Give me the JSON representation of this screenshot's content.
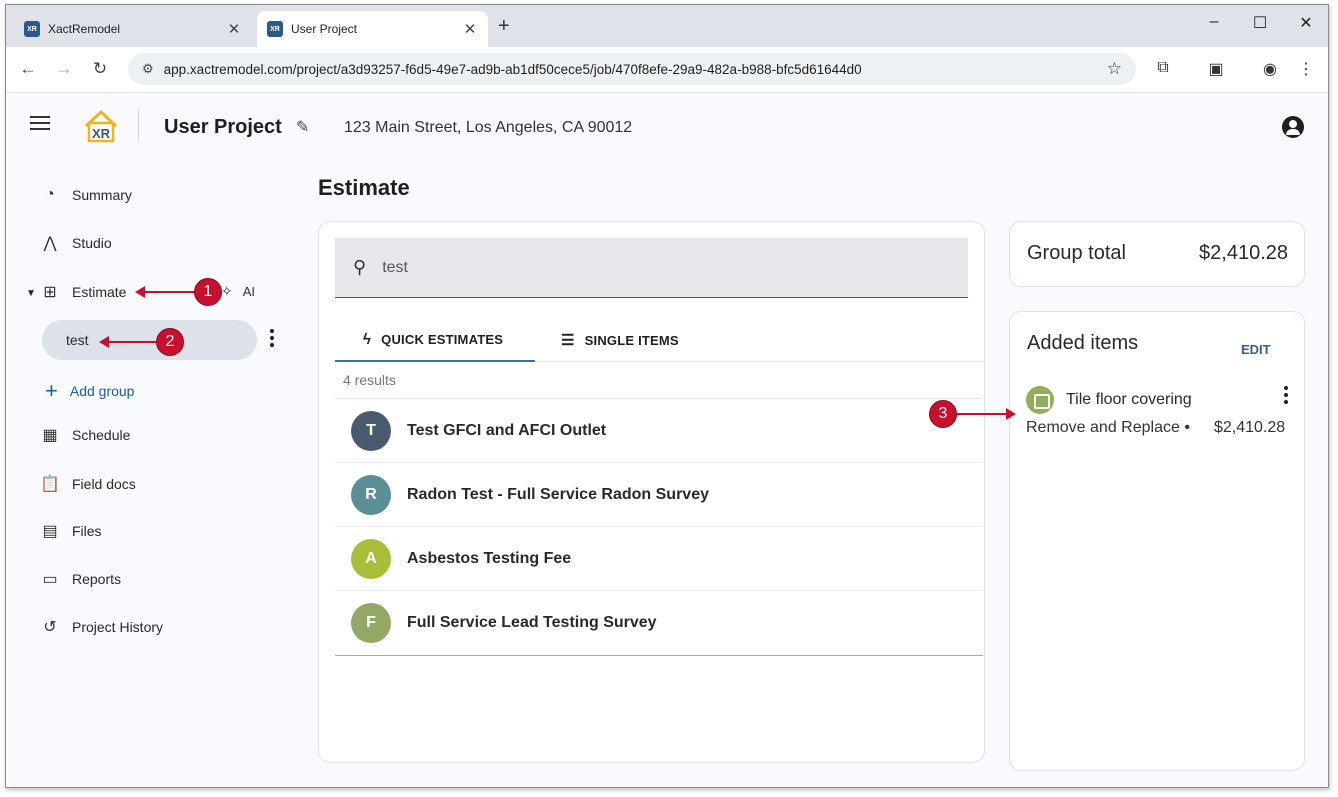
{
  "browser": {
    "tabs": [
      {
        "label": "XactRemodel",
        "favicon": "xr-favicon",
        "close": "✕"
      },
      {
        "label": "User Project",
        "favicon": "xr-favicon",
        "close": "✕"
      }
    ],
    "new_tab": "+",
    "window_controls": {
      "minimize": "–",
      "maximize": "☐",
      "close": "✕"
    },
    "url": "app.xactremodel.com/project/a3d93257-f6d5-49e7-ad9b-ab1df50cece5/job/470f8efe-29a9-482a-b988-bfc5d61644d0",
    "favicon_text": "XR"
  },
  "header": {
    "logo_text": "XR",
    "project_title": "User Project",
    "address": "123 Main Street, Los Angeles, CA 90012"
  },
  "sidebar": {
    "items": [
      {
        "label": "Summary",
        "icon": "gauge-icon"
      },
      {
        "label": "Studio",
        "icon": "compass-icon"
      },
      {
        "label": "Estimate",
        "icon": "calculator-icon"
      },
      {
        "label": "Schedule",
        "icon": "calendar-icon"
      },
      {
        "label": "Field docs",
        "icon": "clipboard-plus-icon"
      },
      {
        "label": "Files",
        "icon": "photo-library-icon"
      },
      {
        "label": "Reports",
        "icon": "document-icon"
      },
      {
        "label": "Project History",
        "icon": "history-icon"
      }
    ],
    "ai_label": "AI",
    "group": "test",
    "add_group": "Add group"
  },
  "main": {
    "heading": "Estimate",
    "search_value": "test",
    "tabs": [
      {
        "label": "QUICK ESTIMATES",
        "icon": "bolt-icon"
      },
      {
        "label": "SINGLE ITEMS",
        "icon": "list-icon"
      }
    ],
    "results_count": "4 results",
    "results": [
      {
        "initial": "T",
        "label": "Test GFCI and AFCI Outlet",
        "color": "#4a5a6e"
      },
      {
        "initial": "R",
        "label": "Radon Test - Full Service Radon Survey",
        "color": "#5b8f95"
      },
      {
        "initial": "A",
        "label": "Asbestos Testing Fee",
        "color": "#a9bd37"
      },
      {
        "initial": "F",
        "label": "Full Service Lead Testing Survey",
        "color": "#93a864"
      }
    ]
  },
  "summary": {
    "group_total_label": "Group total",
    "group_total_value": "$2,410.28",
    "added_items_label": "Added items",
    "edit_label": "EDIT",
    "item": {
      "name": "Tile floor covering",
      "detail": "Remove and Replace • …",
      "price": "$2,410.28",
      "icon_color": "#92ad5c"
    }
  },
  "callouts": [
    "1",
    "2",
    "3"
  ],
  "colors": {
    "accent": "#1a5da8",
    "callout": "#c8102e"
  }
}
